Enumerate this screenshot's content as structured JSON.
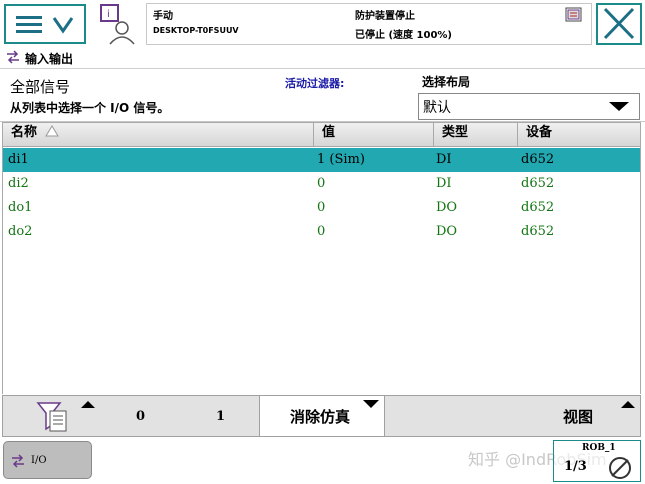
{
  "status": {
    "mode": "手动",
    "controller": "DESKTOP-T0FSUUV",
    "safety": "防护装置停止",
    "state": "已停止 (速度 100%)"
  },
  "app": {
    "title": "输入输出"
  },
  "info": {
    "heading": "全部信号",
    "subtitle": "从列表中选择一个 I/O 信号。",
    "filter_label": "活动过滤器:",
    "layout_label": "选择布局",
    "layout_value": "默认"
  },
  "table": {
    "columns": [
      "名称",
      "值",
      "类型",
      "设备"
    ],
    "rows": [
      {
        "name": "di1",
        "value": "1 (Sim)",
        "type": "DI",
        "device": "d652",
        "selected": true
      },
      {
        "name": "di2",
        "value": "0",
        "type": "DI",
        "device": "d652",
        "selected": false
      },
      {
        "name": "do1",
        "value": "0",
        "type": "DO",
        "device": "d652",
        "selected": false
      },
      {
        "name": "do2",
        "value": "0",
        "type": "DO",
        "device": "d652",
        "selected": false
      }
    ]
  },
  "bottom": {
    "btn0": "0",
    "btn1": "1",
    "sim_clear": "消除仿真",
    "view": "视图"
  },
  "footer": {
    "task_label": "I/O",
    "rob_label": "ROB_1",
    "rob_fraction": "1/3",
    "watermark": "知乎 @IndRobSim"
  },
  "colors": {
    "accent": "#1d8a8a",
    "selected_row": "#21a8b0",
    "signal_text": "#127512"
  }
}
